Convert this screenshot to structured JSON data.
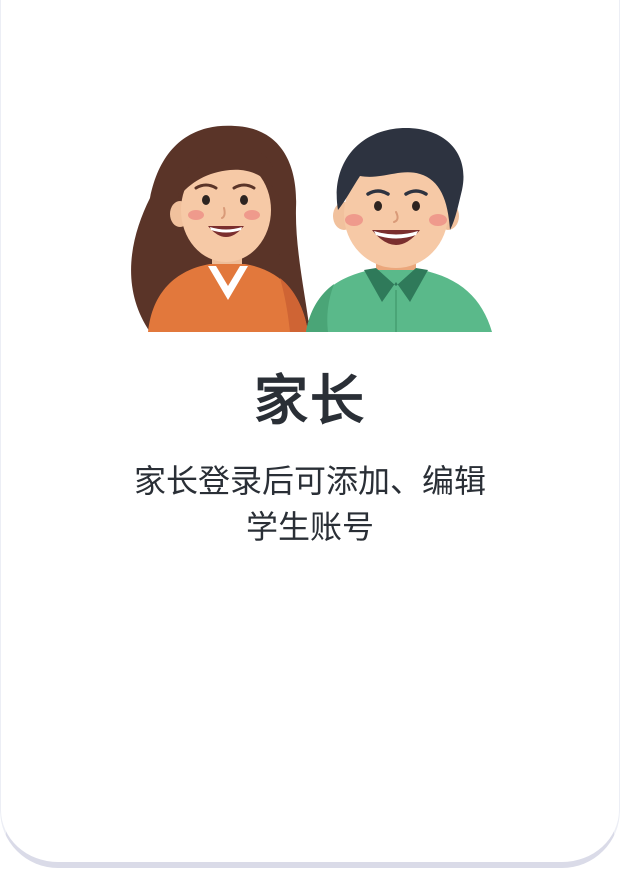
{
  "card": {
    "title": "家长",
    "description_line1": "家长登录后可添加、编辑",
    "description_line2": "学生账号",
    "illustration_icon": "parents-illustration-icon"
  },
  "colors": {
    "text": "#2a2f36",
    "card_edge": "#dadbe8",
    "woman_hair": "#5a3428",
    "woman_shirt": "#e2783c",
    "man_hair": "#2d3340",
    "man_shirt": "#5ab98a",
    "skin": "#f6c9a6"
  }
}
